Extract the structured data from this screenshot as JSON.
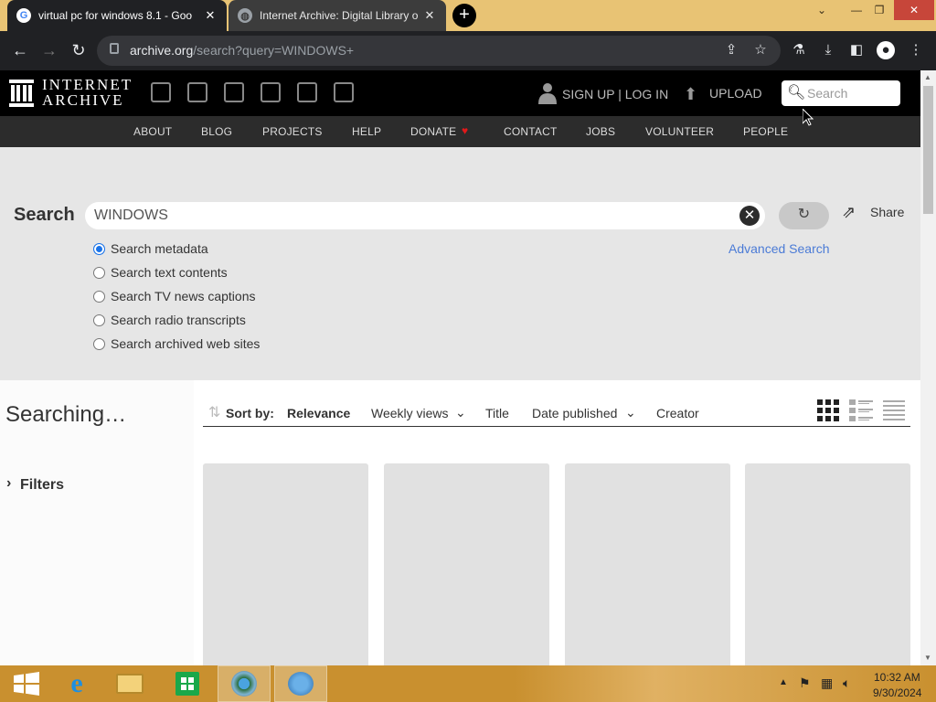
{
  "browser": {
    "tabs": [
      {
        "title": "virtual pc for windows 8.1 - Goo",
        "active": true
      },
      {
        "title": "Internet Archive: Digital Library o",
        "active": false
      }
    ],
    "url_host": "archive.org",
    "url_path": "/search?query=WINDOWS+"
  },
  "ia": {
    "logo_line1": "INTERNET",
    "logo_line2": "ARCHIVE",
    "signup": "SIGN UP | LOG IN",
    "upload": "UPLOAD",
    "search_placeholder": "Search",
    "nav": [
      "ABOUT",
      "BLOG",
      "PROJECTS",
      "HELP",
      "DONATE",
      "CONTACT",
      "JOBS",
      "VOLUNTEER",
      "PEOPLE"
    ]
  },
  "search": {
    "label": "Search",
    "query": "WINDOWS",
    "share": "Share",
    "advanced": "Advanced Search",
    "options": [
      {
        "label": "Search metadata",
        "selected": true
      },
      {
        "label": "Search text contents",
        "selected": false
      },
      {
        "label": "Search TV news captions",
        "selected": false
      },
      {
        "label": "Search radio transcripts",
        "selected": false
      },
      {
        "label": "Search archived web sites",
        "selected": false
      }
    ]
  },
  "results": {
    "status": "Searching…",
    "filters": "Filters",
    "sort_by": "Sort by:",
    "sort_options": [
      "Relevance",
      "Weekly views",
      "Title",
      "Date published",
      "Creator"
    ]
  },
  "taskbar": {
    "time": "10:32 AM",
    "date": "9/30/2024"
  },
  "colors": {
    "accent_blue": "#4b7bd6",
    "donate_heart": "#e0191a",
    "taskbar": "#c9902f"
  }
}
